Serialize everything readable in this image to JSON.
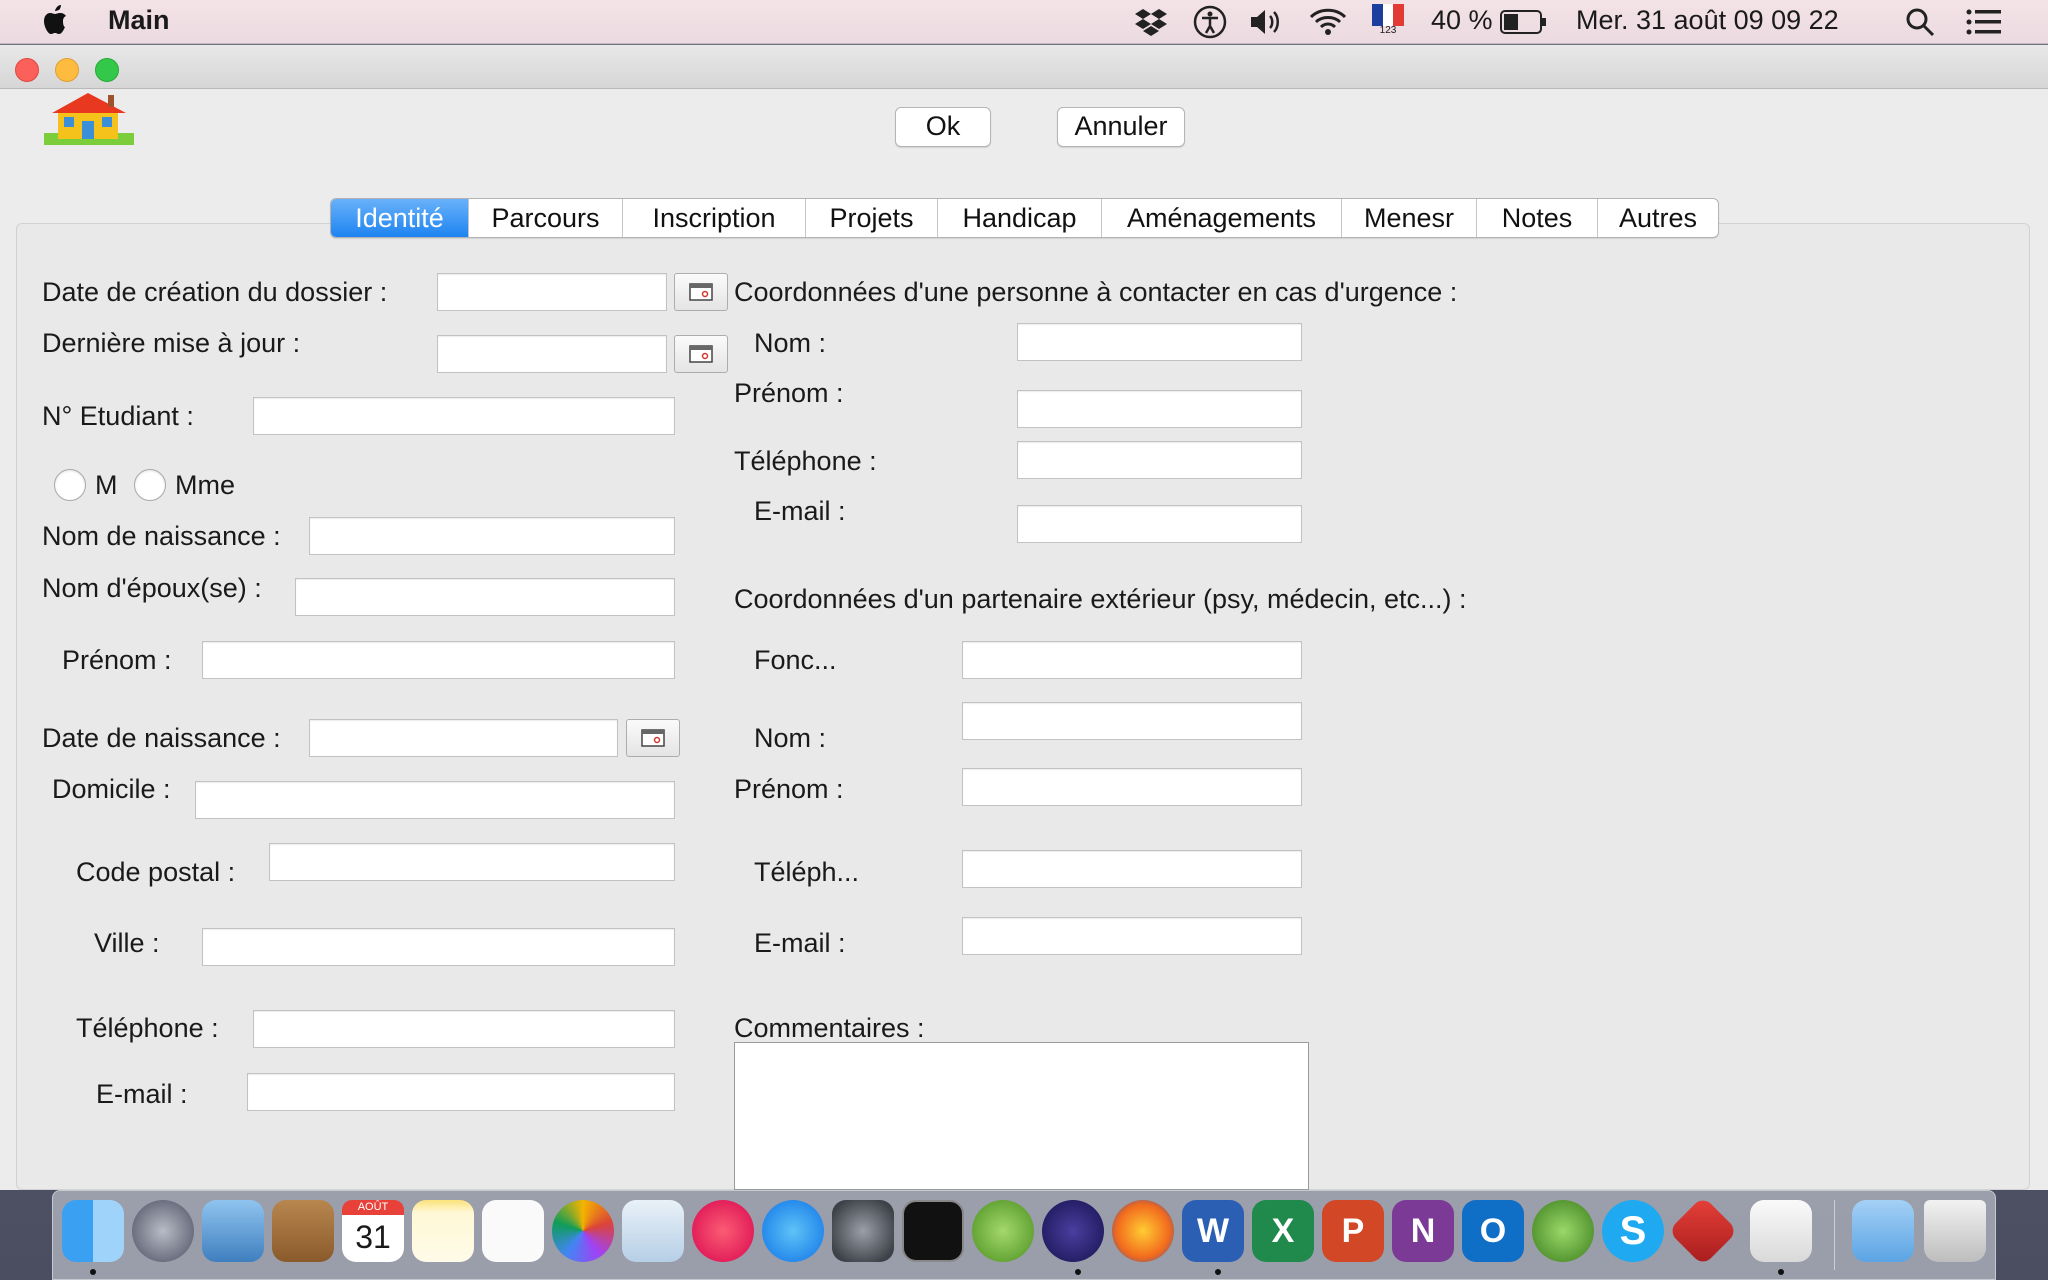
{
  "menubar": {
    "app_name": "Main",
    "battery": "40 %",
    "datetime": "Mer. 31 août  09 09 22",
    "keyboard_sub": "123"
  },
  "toolbar": {
    "ok_label": "Ok",
    "cancel_label": "Annuler"
  },
  "tabs": [
    {
      "label": "Identité"
    },
    {
      "label": "Parcours"
    },
    {
      "label": "Inscription"
    },
    {
      "label": "Projets"
    },
    {
      "label": "Handicap"
    },
    {
      "label": "Aménagements"
    },
    {
      "label": "Menesr"
    },
    {
      "label": "Notes"
    },
    {
      "label": "Autres"
    }
  ],
  "identity": {
    "date_creation": "Date de création du dossier :",
    "derniere_maj": "Dernière mise à jour :",
    "num_etudiant": "N° Etudiant :",
    "civilite_m": "M",
    "civilite_mme": "Mme",
    "nom_naissance": "Nom de naissance :",
    "nom_epoux": "Nom d'époux(se) :",
    "prenom": "Prénom :",
    "date_naissance": "Date de naissance :",
    "domicile": "Domicile :",
    "code_postal": "Code postal :",
    "ville": "Ville :",
    "telephone": "Téléphone :",
    "email": "E-mail :"
  },
  "urgence": {
    "title": "Coordonnées d'une personne à contacter en cas d'urgence :",
    "nom": "Nom :",
    "prenom": "Prénom :",
    "telephone": "Téléphone :",
    "email": "E-mail :"
  },
  "partenaire": {
    "title": "Coordonnées d'un partenaire extérieur (psy, médecin, etc...) :",
    "fonction": "Fonc...",
    "nom": "Nom :",
    "prenom": "Prénom :",
    "telephone": "Téléph...",
    "email": "E-mail :"
  },
  "commentaires": {
    "label": "Commentaires :"
  },
  "dock": {
    "calendar_month": "AOÛT",
    "calendar_day": "31",
    "excel_letter": "X",
    "word_letter": "W",
    "ppt_letter": "P",
    "onenote_letter": "N",
    "outlook_letter": "O",
    "skype_letter": "S"
  }
}
